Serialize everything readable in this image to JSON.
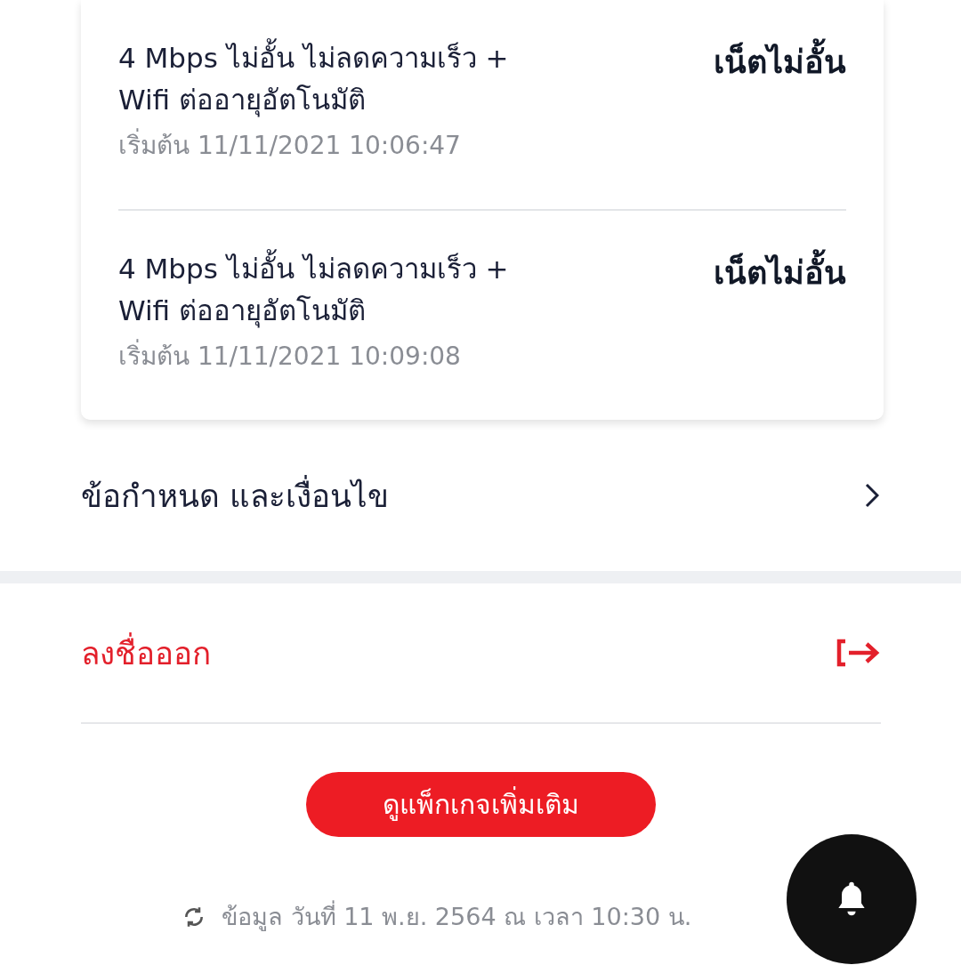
{
  "packages": [
    {
      "title": "4 Mbps ไม่อั้น ไม่ลดความเร็ว + Wifi ต่ออายุอัตโนมัติ",
      "start": "เริ่มต้น 11/11/2021 10:06:47",
      "type_label": "เน็ตไม่อั้น"
    },
    {
      "title": "4 Mbps ไม่อั้น ไม่ลดความเร็ว + Wifi ต่ออายุอัตโนมัติ",
      "start": "เริ่มต้น 11/11/2021 10:09:08",
      "type_label": "เน็ตไม่อั้น"
    }
  ],
  "terms_link": "ข้อกำหนด และเงื่อนไข",
  "logout": "ลงชื่อออก",
  "more_packages_button": "ดูแพ็กเกจเพิ่มเติม",
  "updated_info": "ข้อมูล วันที่ 11 พ.ย. 2564 ณ เวลา 10:30 น."
}
